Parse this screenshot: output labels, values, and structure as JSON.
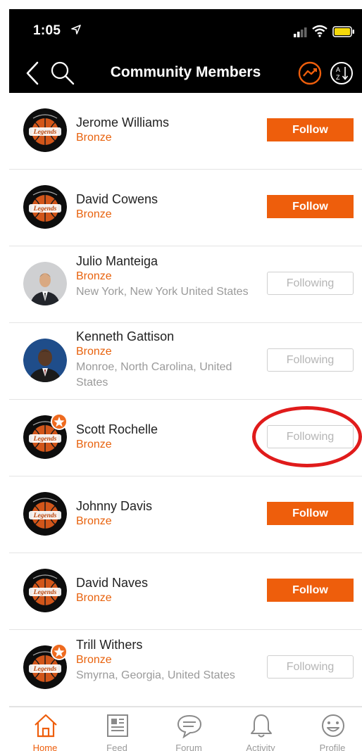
{
  "status_bar": {
    "time": "1:05"
  },
  "nav": {
    "title": "Community Members"
  },
  "colors": {
    "accent": "#ee5e0c",
    "follow_bg": "#ee5e0c",
    "following_border": "#cfcfcf",
    "tier_text": "#e8620d"
  },
  "members": [
    {
      "name": "Jerome Williams",
      "tier": "Bronze",
      "location": "",
      "button": "Follow",
      "status": "follow",
      "avatar": "legends-logo",
      "badge": false
    },
    {
      "name": "David Cowens",
      "tier": "Bronze",
      "location": "",
      "button": "Follow",
      "status": "follow",
      "avatar": "legends-logo",
      "badge": false
    },
    {
      "name": "Julio Manteiga",
      "tier": "Bronze",
      "location": "New York, New York United States",
      "button": "Following",
      "status": "following",
      "avatar": "photo-suit",
      "badge": false
    },
    {
      "name": "Kenneth Gattison",
      "tier": "Bronze",
      "location": "Monroe, North Carolina, United States",
      "button": "Following",
      "status": "following",
      "avatar": "photo-man",
      "badge": false
    },
    {
      "name": "Scott Rochelle",
      "tier": "Bronze",
      "location": "",
      "button": "Following",
      "status": "following",
      "avatar": "legends-logo",
      "badge": true
    },
    {
      "name": "Johnny Davis",
      "tier": "Bronze",
      "location": "",
      "button": "Follow",
      "status": "follow",
      "avatar": "legends-logo",
      "badge": false
    },
    {
      "name": "David Naves",
      "tier": "Bronze",
      "location": "",
      "button": "Follow",
      "status": "follow",
      "avatar": "legends-logo",
      "badge": false
    },
    {
      "name": "Trill Withers",
      "tier": "Bronze",
      "location": "Smyrna, Georgia, United States",
      "button": "Following",
      "status": "following",
      "avatar": "legends-logo",
      "badge": true
    }
  ],
  "tabs": [
    {
      "label": "Home",
      "icon": "home-icon",
      "active": true
    },
    {
      "label": "Feed",
      "icon": "feed-icon",
      "active": false
    },
    {
      "label": "Forum",
      "icon": "forum-icon",
      "active": false
    },
    {
      "label": "Activity",
      "icon": "bell-icon",
      "active": false
    },
    {
      "label": "Profile",
      "icon": "smiley-icon",
      "active": false
    }
  ]
}
